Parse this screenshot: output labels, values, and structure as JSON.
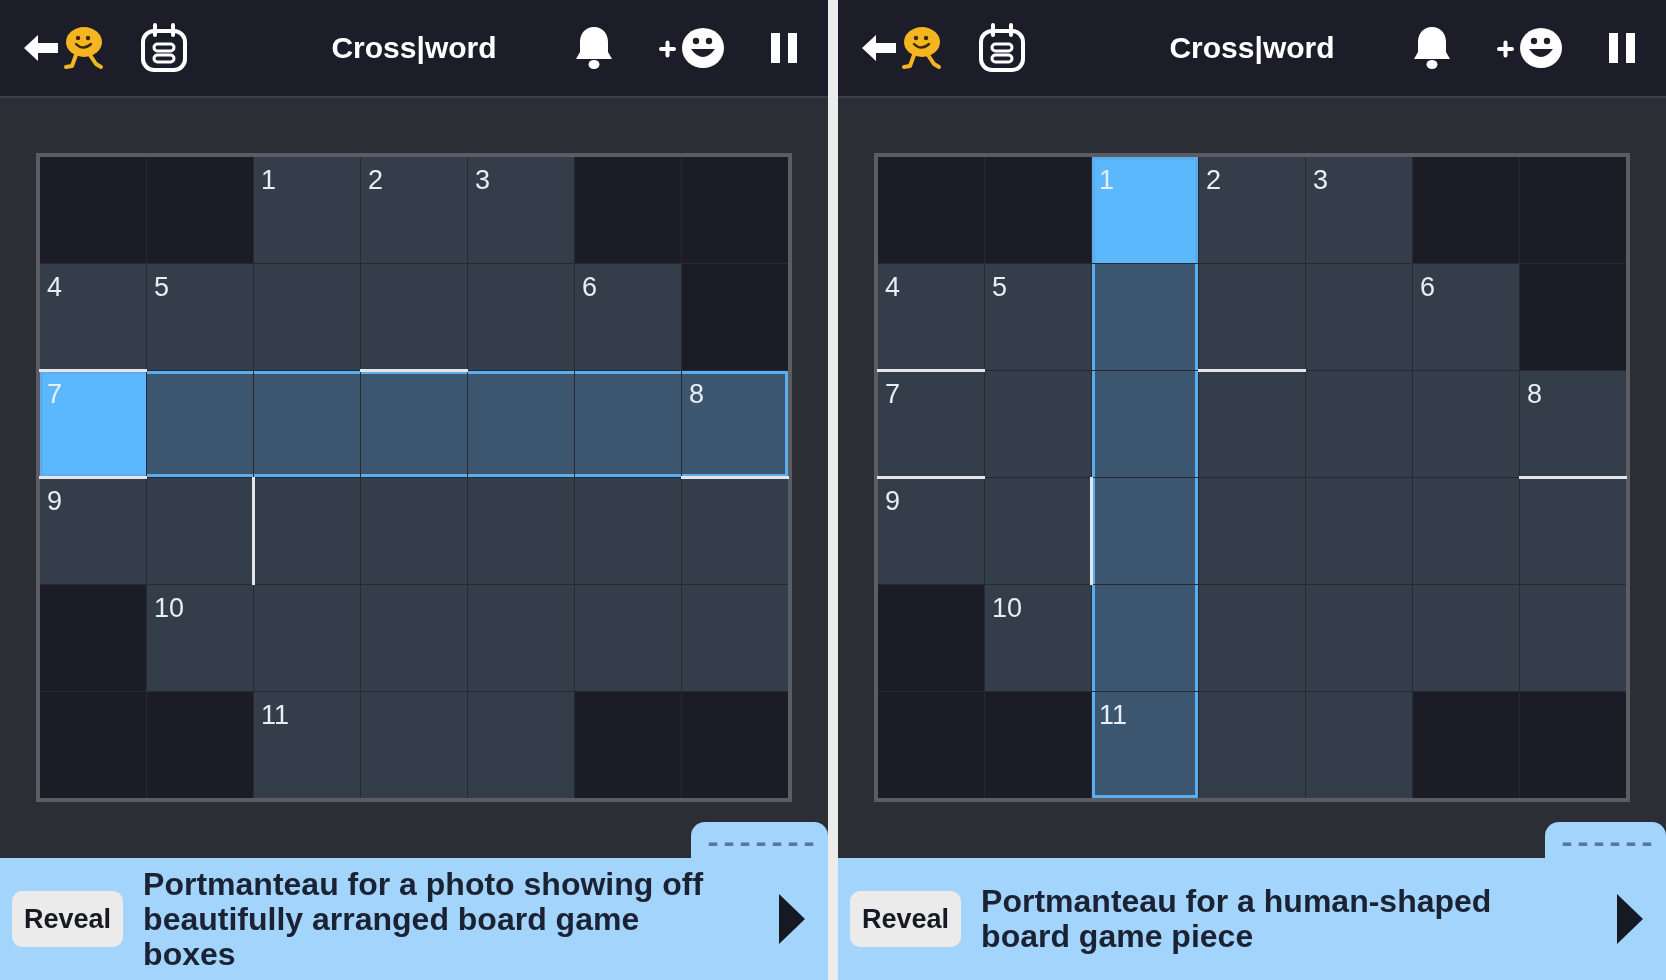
{
  "panels": [
    {
      "header": {
        "title": "Cross|word"
      },
      "grid": {
        "rows": [
          [
            {
              "kind": "block",
              "selected": false,
              "in_word": false,
              "bar_top": false,
              "bar_left": false
            },
            {
              "kind": "block",
              "selected": false,
              "in_word": false,
              "bar_top": false,
              "bar_left": false
            },
            {
              "kind": "open",
              "number": "1",
              "selected": false,
              "in_word": false,
              "bar_top": false,
              "bar_left": false
            },
            {
              "kind": "open",
              "number": "2",
              "selected": false,
              "in_word": false,
              "bar_top": false,
              "bar_left": false
            },
            {
              "kind": "open",
              "number": "3",
              "selected": false,
              "in_word": false,
              "bar_top": false,
              "bar_left": false
            },
            {
              "kind": "block",
              "selected": false,
              "in_word": false,
              "bar_top": false,
              "bar_left": false
            },
            {
              "kind": "block",
              "selected": false,
              "in_word": false,
              "bar_top": false,
              "bar_left": false
            }
          ],
          [
            {
              "kind": "open",
              "number": "4",
              "selected": false,
              "in_word": false,
              "bar_top": false,
              "bar_left": false
            },
            {
              "kind": "open",
              "number": "5",
              "selected": false,
              "in_word": false,
              "bar_top": false,
              "bar_left": false
            },
            {
              "kind": "open",
              "selected": false,
              "in_word": false,
              "bar_top": false,
              "bar_left": false
            },
            {
              "kind": "open",
              "selected": false,
              "in_word": false,
              "bar_top": false,
              "bar_left": false
            },
            {
              "kind": "open",
              "selected": false,
              "in_word": false,
              "bar_top": false,
              "bar_left": false
            },
            {
              "kind": "open",
              "number": "6",
              "selected": false,
              "in_word": false,
              "bar_top": false,
              "bar_left": false
            },
            {
              "kind": "block",
              "selected": false,
              "in_word": false,
              "bar_top": false,
              "bar_left": false
            }
          ],
          [
            {
              "kind": "open",
              "number": "7",
              "selected": true,
              "in_word": true,
              "bar_top": true,
              "bar_left": false
            },
            {
              "kind": "open",
              "selected": false,
              "in_word": true,
              "bar_top": false,
              "bar_left": false
            },
            {
              "kind": "open",
              "selected": false,
              "in_word": true,
              "bar_top": false,
              "bar_left": false
            },
            {
              "kind": "open",
              "selected": false,
              "in_word": true,
              "bar_top": true,
              "bar_left": false
            },
            {
              "kind": "open",
              "selected": false,
              "in_word": true,
              "bar_top": false,
              "bar_left": false
            },
            {
              "kind": "open",
              "selected": false,
              "in_word": true,
              "bar_top": false,
              "bar_left": false
            },
            {
              "kind": "open",
              "number": "8",
              "selected": false,
              "in_word": true,
              "bar_top": false,
              "bar_left": false
            }
          ],
          [
            {
              "kind": "open",
              "number": "9",
              "selected": false,
              "in_word": false,
              "bar_top": true,
              "bar_left": false
            },
            {
              "kind": "open",
              "selected": false,
              "in_word": false,
              "bar_top": false,
              "bar_left": false
            },
            {
              "kind": "open",
              "selected": false,
              "in_word": false,
              "bar_top": false,
              "bar_left": true
            },
            {
              "kind": "open",
              "selected": false,
              "in_word": false,
              "bar_top": false,
              "bar_left": false
            },
            {
              "kind": "open",
              "selected": false,
              "in_word": false,
              "bar_top": false,
              "bar_left": false
            },
            {
              "kind": "open",
              "selected": false,
              "in_word": false,
              "bar_top": false,
              "bar_left": false
            },
            {
              "kind": "open",
              "selected": false,
              "in_word": false,
              "bar_top": true,
              "bar_left": false
            }
          ],
          [
            {
              "kind": "block",
              "selected": false,
              "in_word": false,
              "bar_top": false,
              "bar_left": false
            },
            {
              "kind": "open",
              "number": "10",
              "selected": false,
              "in_word": false,
              "bar_top": false,
              "bar_left": false
            },
            {
              "kind": "open",
              "selected": false,
              "in_word": false,
              "bar_top": false,
              "bar_left": false
            },
            {
              "kind": "open",
              "selected": false,
              "in_word": false,
              "bar_top": false,
              "bar_left": false
            },
            {
              "kind": "open",
              "selected": false,
              "in_word": false,
              "bar_top": false,
              "bar_left": false
            },
            {
              "kind": "open",
              "selected": false,
              "in_word": false,
              "bar_top": false,
              "bar_left": false
            },
            {
              "kind": "open",
              "selected": false,
              "in_word": false,
              "bar_top": false,
              "bar_left": false
            }
          ],
          [
            {
              "kind": "block",
              "selected": false,
              "in_word": false,
              "bar_top": false,
              "bar_left": false
            },
            {
              "kind": "block",
              "selected": false,
              "in_word": false,
              "bar_top": false,
              "bar_left": false
            },
            {
              "kind": "open",
              "number": "11",
              "selected": false,
              "in_word": false,
              "bar_top": false,
              "bar_left": false
            },
            {
              "kind": "open",
              "selected": false,
              "in_word": false,
              "bar_top": false,
              "bar_left": false
            },
            {
              "kind": "open",
              "selected": false,
              "in_word": false,
              "bar_top": false,
              "bar_left": false
            },
            {
              "kind": "block",
              "selected": false,
              "in_word": false,
              "bar_top": false,
              "bar_left": false
            },
            {
              "kind": "block",
              "selected": false,
              "in_word": false,
              "bar_top": false,
              "bar_left": false
            }
          ]
        ]
      },
      "clue": {
        "answer_pattern": "-------",
        "reveal_label": "Reveal",
        "text": "Portmanteau for a photo showing off beautifully arranged board game boxes"
      }
    },
    {
      "header": {
        "title": "Cross|word"
      },
      "grid": {
        "rows": [
          [
            {
              "kind": "block",
              "selected": false,
              "in_word": false,
              "bar_top": false,
              "bar_left": false
            },
            {
              "kind": "block",
              "selected": false,
              "in_word": false,
              "bar_top": false,
              "bar_left": false
            },
            {
              "kind": "open",
              "number": "1",
              "selected": true,
              "in_word": true,
              "bar_top": false,
              "bar_left": false
            },
            {
              "kind": "open",
              "number": "2",
              "selected": false,
              "in_word": false,
              "bar_top": false,
              "bar_left": false
            },
            {
              "kind": "open",
              "number": "3",
              "selected": false,
              "in_word": false,
              "bar_top": false,
              "bar_left": false
            },
            {
              "kind": "block",
              "selected": false,
              "in_word": false,
              "bar_top": false,
              "bar_left": false
            },
            {
              "kind": "block",
              "selected": false,
              "in_word": false,
              "bar_top": false,
              "bar_left": false
            }
          ],
          [
            {
              "kind": "open",
              "number": "4",
              "selected": false,
              "in_word": false,
              "bar_top": false,
              "bar_left": false
            },
            {
              "kind": "open",
              "number": "5",
              "selected": false,
              "in_word": false,
              "bar_top": false,
              "bar_left": false
            },
            {
              "kind": "open",
              "selected": false,
              "in_word": true,
              "bar_top": false,
              "bar_left": false
            },
            {
              "kind": "open",
              "selected": false,
              "in_word": false,
              "bar_top": false,
              "bar_left": false
            },
            {
              "kind": "open",
              "selected": false,
              "in_word": false,
              "bar_top": false,
              "bar_left": false
            },
            {
              "kind": "open",
              "number": "6",
              "selected": false,
              "in_word": false,
              "bar_top": false,
              "bar_left": false
            },
            {
              "kind": "block",
              "selected": false,
              "in_word": false,
              "bar_top": false,
              "bar_left": false
            }
          ],
          [
            {
              "kind": "open",
              "number": "7",
              "selected": false,
              "in_word": false,
              "bar_top": true,
              "bar_left": false
            },
            {
              "kind": "open",
              "selected": false,
              "in_word": false,
              "bar_top": false,
              "bar_left": false
            },
            {
              "kind": "open",
              "selected": false,
              "in_word": true,
              "bar_top": false,
              "bar_left": false
            },
            {
              "kind": "open",
              "selected": false,
              "in_word": false,
              "bar_top": true,
              "bar_left": false
            },
            {
              "kind": "open",
              "selected": false,
              "in_word": false,
              "bar_top": false,
              "bar_left": false
            },
            {
              "kind": "open",
              "selected": false,
              "in_word": false,
              "bar_top": false,
              "bar_left": false
            },
            {
              "kind": "open",
              "number": "8",
              "selected": false,
              "in_word": false,
              "bar_top": false,
              "bar_left": false
            }
          ],
          [
            {
              "kind": "open",
              "number": "9",
              "selected": false,
              "in_word": false,
              "bar_top": true,
              "bar_left": false
            },
            {
              "kind": "open",
              "selected": false,
              "in_word": false,
              "bar_top": false,
              "bar_left": false
            },
            {
              "kind": "open",
              "selected": false,
              "in_word": true,
              "bar_top": false,
              "bar_left": true
            },
            {
              "kind": "open",
              "selected": false,
              "in_word": false,
              "bar_top": false,
              "bar_left": false
            },
            {
              "kind": "open",
              "selected": false,
              "in_word": false,
              "bar_top": false,
              "bar_left": false
            },
            {
              "kind": "open",
              "selected": false,
              "in_word": false,
              "bar_top": false,
              "bar_left": false
            },
            {
              "kind": "open",
              "selected": false,
              "in_word": false,
              "bar_top": true,
              "bar_left": false
            }
          ],
          [
            {
              "kind": "block",
              "selected": false,
              "in_word": false,
              "bar_top": false,
              "bar_left": false
            },
            {
              "kind": "open",
              "number": "10",
              "selected": false,
              "in_word": false,
              "bar_top": false,
              "bar_left": false
            },
            {
              "kind": "open",
              "selected": false,
              "in_word": true,
              "bar_top": false,
              "bar_left": false
            },
            {
              "kind": "open",
              "selected": false,
              "in_word": false,
              "bar_top": false,
              "bar_left": false
            },
            {
              "kind": "open",
              "selected": false,
              "in_word": false,
              "bar_top": false,
              "bar_left": false
            },
            {
              "kind": "open",
              "selected": false,
              "in_word": false,
              "bar_top": false,
              "bar_left": false
            },
            {
              "kind": "open",
              "selected": false,
              "in_word": false,
              "bar_top": false,
              "bar_left": false
            }
          ],
          [
            {
              "kind": "block",
              "selected": false,
              "in_word": false,
              "bar_top": false,
              "bar_left": false
            },
            {
              "kind": "block",
              "selected": false,
              "in_word": false,
              "bar_top": false,
              "bar_left": false
            },
            {
              "kind": "open",
              "number": "11",
              "selected": false,
              "in_word": true,
              "bar_top": false,
              "bar_left": false
            },
            {
              "kind": "open",
              "selected": false,
              "in_word": false,
              "bar_top": false,
              "bar_left": false
            },
            {
              "kind": "open",
              "selected": false,
              "in_word": false,
              "bar_top": false,
              "bar_left": false
            },
            {
              "kind": "block",
              "selected": false,
              "in_word": false,
              "bar_top": false,
              "bar_left": false
            },
            {
              "kind": "block",
              "selected": false,
              "in_word": false,
              "bar_top": false,
              "bar_left": false
            }
          ]
        ]
      },
      "clue": {
        "answer_pattern": "------",
        "reveal_label": "Reveal",
        "text": "Portmanteau for a human-shaped board game piece"
      }
    }
  ]
}
